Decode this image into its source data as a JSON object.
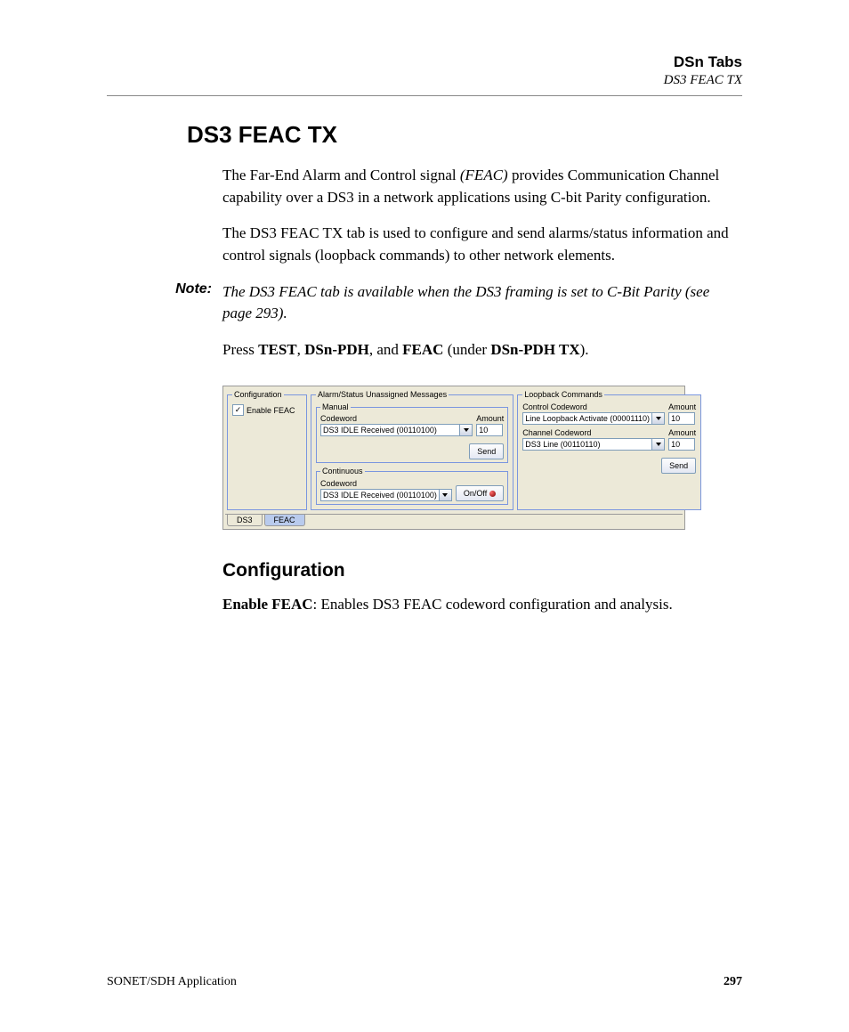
{
  "header": {
    "chapter": "DSn Tabs",
    "section": "DS3 FEAC TX"
  },
  "title": "DS3 FEAC TX",
  "intro_html": "The Far-End Alarm and Control signal <i>(FEAC)</i> provides Communication Channel capability over a DS3 in a network applications using C-bit Parity configuration.",
  "intro2": "The DS3 FEAC TX tab is used to configure and send alarms/status information and control signals (loopback commands) to other network elements.",
  "note_label": "Note:",
  "note_html": "The DS3 FEAC tab is available when the DS3 framing is set to C-Bit Parity (see page 293).",
  "press_html": "Press <b>TEST</b>, <b>DSn-PDH</b>, and <b>FEAC</b> (under <b>DSn-PDH TX</b>).",
  "ui": {
    "config": {
      "legend": "Configuration",
      "enable_label": "Enable FEAC",
      "enable_checked": true
    },
    "alarm": {
      "legend": "Alarm/Status  Unassigned Messages",
      "manual": {
        "legend": "Manual",
        "codeword_label": "Codeword",
        "codeword_value": "DS3 IDLE Received (00110100)",
        "amount_label": "Amount",
        "amount_value": "10",
        "send_label": "Send"
      },
      "continuous": {
        "legend": "Continuous",
        "codeword_label": "Codeword",
        "codeword_value": "DS3 IDLE Received (00110100)",
        "onoff_label": "On/Off"
      }
    },
    "loopback": {
      "legend": "Loopback Commands",
      "control_label": "Control Codeword",
      "control_value": "Line Loopback Activate (00001110)",
      "control_amount_label": "Amount",
      "control_amount_value": "10",
      "channel_label": "Channel Codeword",
      "channel_value": "DS3 Line (00110110)",
      "channel_amount_label": "Amount",
      "channel_amount_value": "10",
      "send_label": "Send"
    },
    "tabs": {
      "ds3": "DS3",
      "feac": "FEAC"
    }
  },
  "config_heading": "Configuration",
  "config_body_html": "<b>Enable FEAC</b>: Enables DS3 FEAC codeword configuration and analysis.",
  "footer": {
    "left": "SONET/SDH Application",
    "page": "297"
  }
}
